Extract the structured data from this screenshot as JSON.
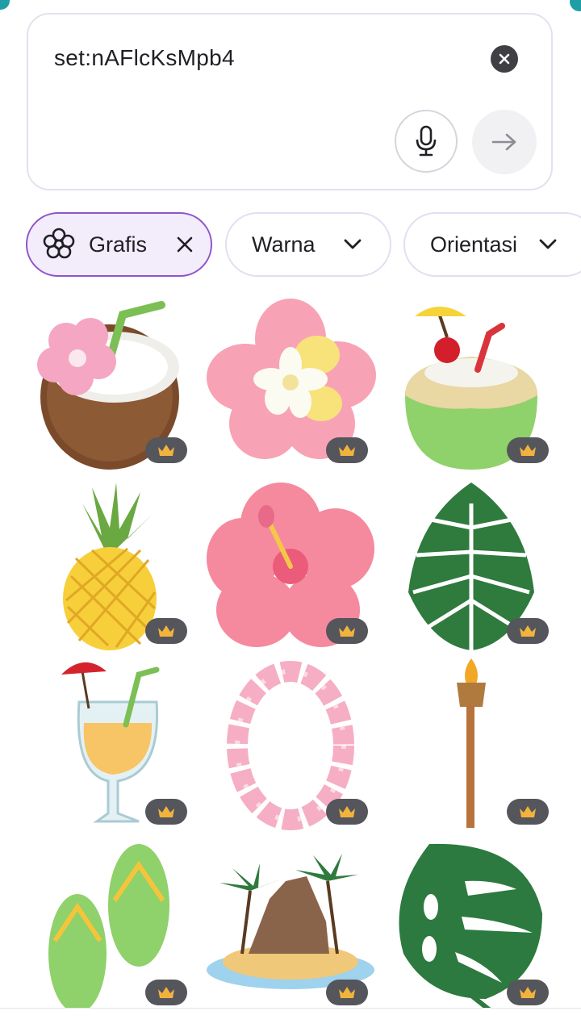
{
  "search": {
    "query": "set:nAFlcKsMpb4",
    "clear_icon": "close-circle-icon",
    "mic_icon": "microphone-icon",
    "submit_icon": "arrow-right-icon"
  },
  "filters": [
    {
      "label": "Grafis",
      "active": true,
      "icon": "flower-icon",
      "trailing_icon": "close-icon"
    },
    {
      "label": "Warna",
      "active": false,
      "trailing_icon": "chevron-down-icon"
    },
    {
      "label": "Orientasi",
      "active": false,
      "trailing_icon": "chevron-down-icon"
    }
  ],
  "results": [
    {
      "name": "coconut-drink-with-flower",
      "badge": "crown-icon"
    },
    {
      "name": "plumeria-flower",
      "badge": "crown-icon"
    },
    {
      "name": "green-coconut-drink",
      "badge": "crown-icon"
    },
    {
      "name": "pineapple",
      "badge": "crown-icon"
    },
    {
      "name": "hibiscus-flower",
      "badge": "crown-icon"
    },
    {
      "name": "palm-leaf",
      "badge": "crown-icon"
    },
    {
      "name": "cocktail-glass",
      "badge": "crown-icon"
    },
    {
      "name": "flower-lei",
      "badge": "crown-icon"
    },
    {
      "name": "tiki-torch",
      "badge": "crown-icon"
    },
    {
      "name": "flip-flops",
      "badge": "crown-icon"
    },
    {
      "name": "tropical-island",
      "badge": "crown-icon"
    },
    {
      "name": "monstera-leaf",
      "badge": "crown-icon"
    }
  ],
  "colors": {
    "accent": "#8e55c9",
    "accent_bg": "#f3ecfb",
    "badge_bg": "#55555c",
    "crown": "#f2b33d"
  }
}
